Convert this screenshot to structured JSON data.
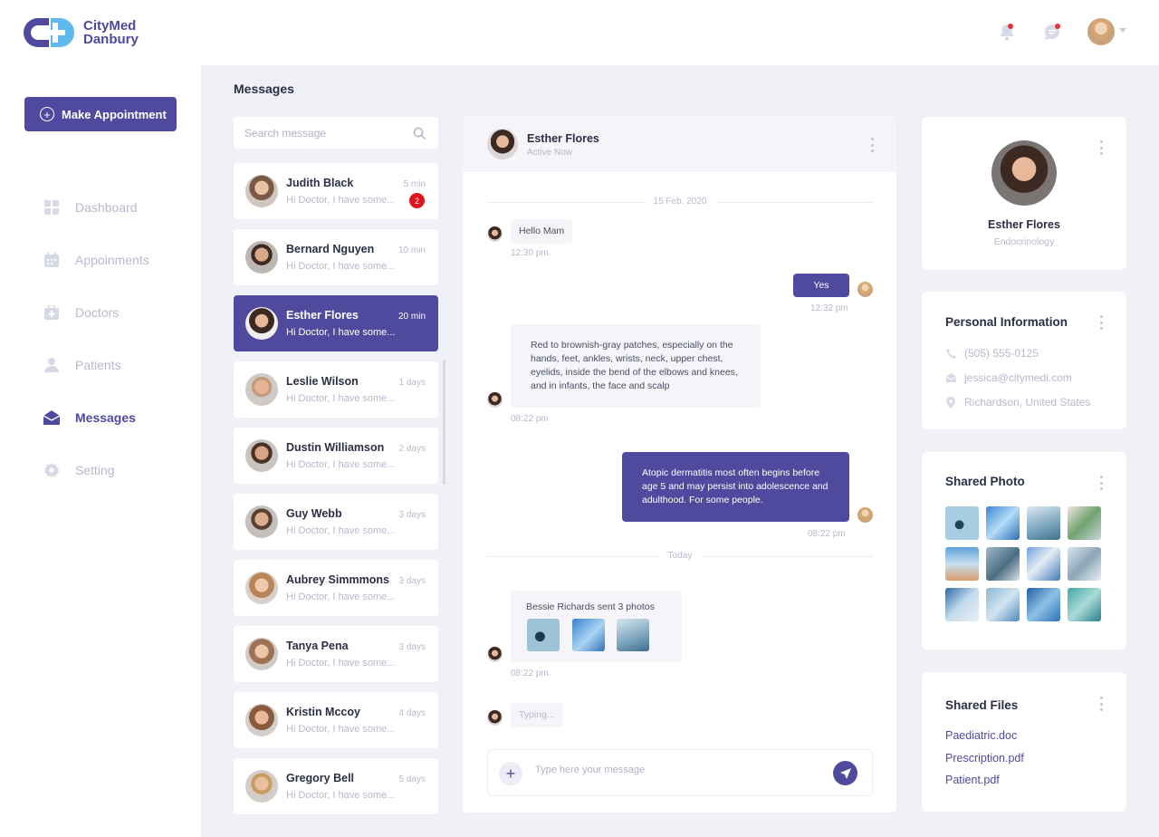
{
  "brand": {
    "line1": "CityMed",
    "line2": "Danbury",
    "color": "#4f4a9e"
  },
  "sidebar": {
    "make_appointment_label": "Make Appointment",
    "items": [
      {
        "label": "Dashboard",
        "icon": "dashboard-icon"
      },
      {
        "label": "Appoinments",
        "icon": "calendar-icon"
      },
      {
        "label": "Doctors",
        "icon": "medical-bag-icon"
      },
      {
        "label": "Patients",
        "icon": "user-icon"
      },
      {
        "label": "Messages",
        "icon": "envelope-icon",
        "active": true
      },
      {
        "label": "Setting",
        "icon": "gear-icon"
      }
    ]
  },
  "topbar": {
    "icons": [
      "bell-icon",
      "chat-bubble-icon",
      "avatar"
    ],
    "notification_color": "#e8303a"
  },
  "page_title": "Messages",
  "search": {
    "placeholder": "Search message"
  },
  "conversations": [
    {
      "name": "Judith Black",
      "preview": "Hi Doctor, I have some...",
      "time": "5 min",
      "badge": "2"
    },
    {
      "name": "Bernard Nguyen",
      "preview": "Hi Doctor, I have some...",
      "time": "10 min"
    },
    {
      "name": "Esther Flores",
      "preview": "Hi Doctor, I have some...",
      "time": "20 min",
      "active": true
    },
    {
      "name": "Leslie Wilson",
      "preview": "Hi Doctor, I have some...",
      "time": "1 days"
    },
    {
      "name": "Dustin Williamson",
      "preview": "Hi Doctor, I have some...",
      "time": "2 days"
    },
    {
      "name": "Guy Webb",
      "preview": "Hi Doctor, I have some...",
      "time": "3 days"
    },
    {
      "name": "Aubrey Simmmons",
      "preview": "Hi Doctor, I have some...",
      "time": "3 days"
    },
    {
      "name": "Tanya Pena",
      "preview": "Hi Doctor, I have some...",
      "time": "3 days"
    },
    {
      "name": "Kristin Mccoy",
      "preview": "Hi Doctor, I have some...",
      "time": "4 days"
    },
    {
      "name": "Gregory Bell",
      "preview": "Hi Doctor, I have some...",
      "time": "5 days"
    }
  ],
  "chat": {
    "header": {
      "name": "Esther Flores",
      "status": "Active Now"
    },
    "date_divider": "15 Feb, 2020",
    "today_divider": "Today",
    "messages": [
      {
        "text": "Hello Mam",
        "time": "12:30 pm",
        "direction": "in"
      },
      {
        "text": "Yes",
        "time": "12:32 pm",
        "direction": "out"
      },
      {
        "text": "Red to brownish-gray patches, especially on the hands, feet, ankles, wrists, neck, upper chest, eyelids, inside the bend of the elbows and knees, and in infants, the face and scalp",
        "time": "08:22 pm",
        "direction": "in"
      },
      {
        "text": "Atopic dermatitis most often begins before age 5 and may persist into adolescence and adulthood. For some people.",
        "time": "08:22 pm",
        "direction": "out"
      },
      {
        "text": "Bessie Richards sent 3 photos",
        "time": "08:22 pm",
        "direction": "in"
      }
    ],
    "typing": "Typing...",
    "composer_placeholder": "Type here your message"
  },
  "profile": {
    "name": "Esther Flores",
    "specialty": "Endocrinology"
  },
  "personal_info": {
    "title": "Personal Information",
    "phone": "(505) 555-0125",
    "email": "jessica@citymedi.com",
    "location": "Richardson, United States"
  },
  "shared_photo": {
    "title": "Shared Photo",
    "count": 12
  },
  "shared_files": {
    "title": "Shared Files",
    "files": [
      "Paediatric.doc",
      "Prescription.pdf",
      "Patient.pdf"
    ]
  }
}
